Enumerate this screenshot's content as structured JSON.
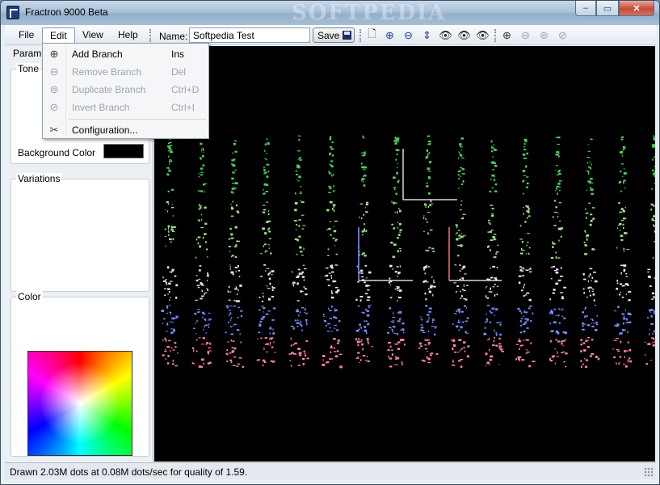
{
  "window": {
    "title": "Fractron 9000 Beta",
    "watermark": "SOFTPEDIA",
    "min_label": "–",
    "max_label": "▭",
    "close_label": "✕"
  },
  "menu": {
    "file": "File",
    "edit": "Edit",
    "view": "View",
    "help": "Help"
  },
  "toolbar": {
    "name_label": "Name:",
    "name_value": "Softpedia Test",
    "save_label": "Save"
  },
  "icons": {
    "new": "new-document-icon",
    "zoom_in": "zoom-in-icon",
    "zoom_out": "zoom-out-icon",
    "fit": "fit-vertical-icon",
    "preview1": "eye-icon",
    "preview2": "eye-icon",
    "preview3": "eye-star-icon",
    "add_branch": "add-branch-icon",
    "remove_branch": "remove-branch-icon",
    "duplicate_branch": "duplicate-branch-icon",
    "invert_branch": "invert-branch-icon"
  },
  "left_panel": {
    "tab": "Parame",
    "tone_title": "Tone",
    "background_color_label": "Background Color",
    "background_color": "#000000",
    "variations_title": "Variations",
    "color_title": "Color"
  },
  "edit_menu": [
    {
      "label": "Add Branch",
      "shortcut": "Ins",
      "enabled": true
    },
    {
      "label": "Remove Branch",
      "shortcut": "Del",
      "enabled": false
    },
    {
      "label": "Duplicate Branch",
      "shortcut": "Ctrl+D",
      "enabled": false
    },
    {
      "label": "Invert Branch",
      "shortcut": "Ctrl+I",
      "enabled": false
    },
    {
      "label": "Configuration...",
      "shortcut": "",
      "enabled": true
    }
  ],
  "status": {
    "text": "Drawn   2.03M dots at   0.08M dots/sec for quality of   1.59."
  }
}
